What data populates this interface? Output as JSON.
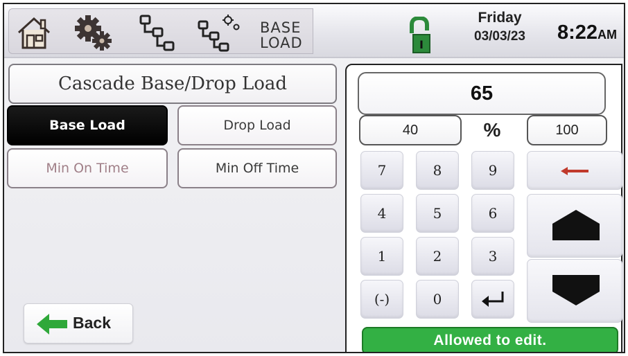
{
  "header": {
    "mode_line1": "BASE",
    "mode_line2": "LOAD",
    "day": "Friday",
    "date": "03/03/23",
    "time": "8:22",
    "ampm": "AM",
    "icons": [
      "home-icon",
      "gears-icon",
      "network-icon",
      "network-settings-icon",
      "lock-icon"
    ]
  },
  "screen": {
    "title": "Cascade Base/Drop Load",
    "options": {
      "base_load": "Base Load",
      "drop_load": "Drop Load",
      "min_on_time": "Min On Time",
      "min_off_time": "Min Off Time"
    },
    "back_label": "Back"
  },
  "keypad": {
    "value": "65",
    "min": "40",
    "unit": "%",
    "max": "100",
    "keys": {
      "k7": "7",
      "k8": "8",
      "k9": "9",
      "k4": "4",
      "k5": "5",
      "k6": "6",
      "k1": "1",
      "k2": "2",
      "k3": "3",
      "neg": "(-)",
      "k0": "0"
    },
    "status": "Allowed to edit."
  },
  "colors": {
    "status_green": "#33b044",
    "back_arrow_green": "#2fa83a",
    "backspace_arrow": "#c0392b",
    "lock_green": "#2c8a3b"
  }
}
